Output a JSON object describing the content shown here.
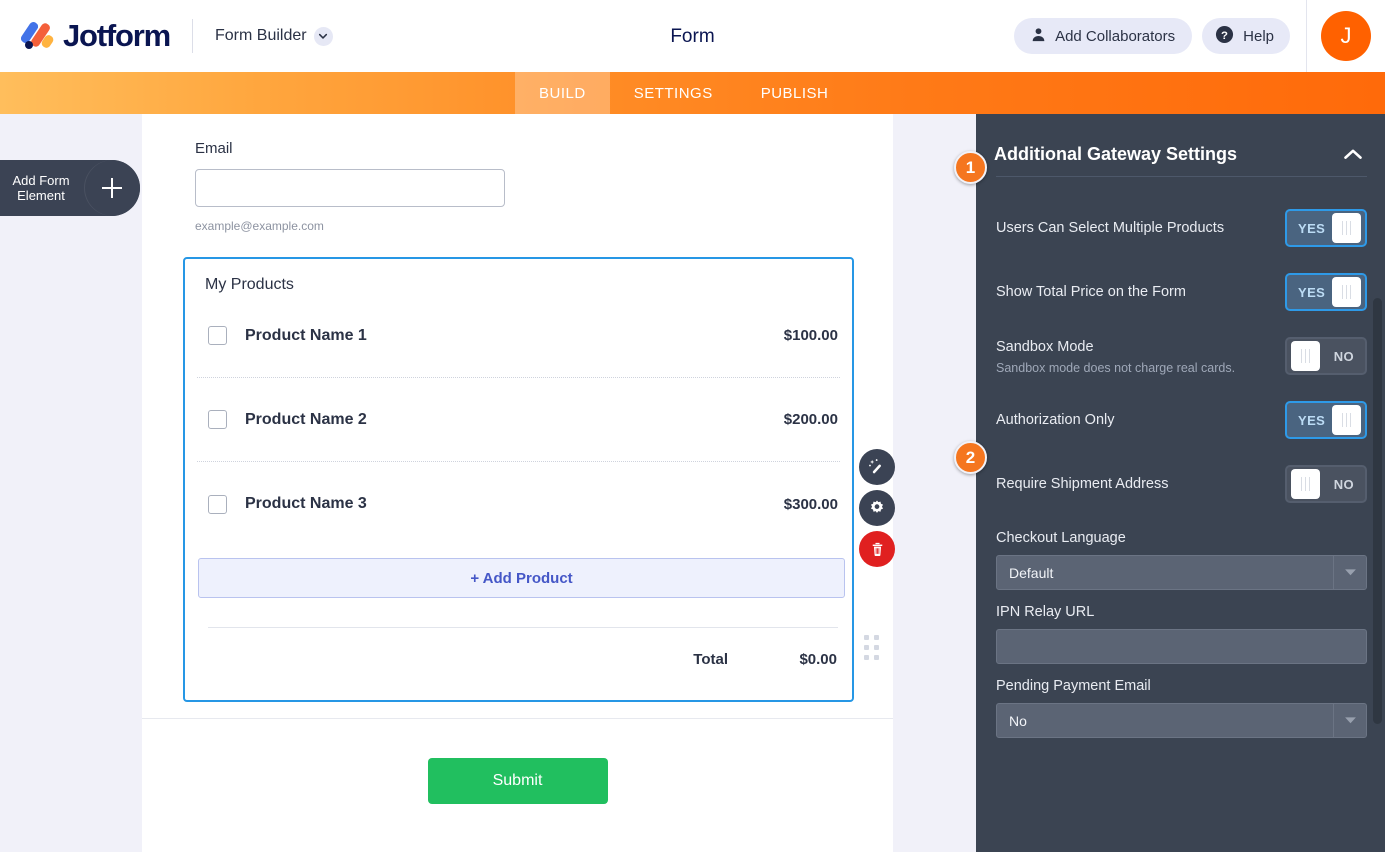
{
  "header": {
    "brand": "Jotform",
    "menu_label": "Form Builder",
    "form_title": "Form",
    "add_collaborators_label": "Add Collaborators",
    "help_label": "Help",
    "avatar_initial": "J",
    "icons": {
      "brand_logo": "jotform-logo",
      "chevron": "chevron-down-icon",
      "person": "person-icon",
      "question": "question-mark-icon"
    }
  },
  "tabs": [
    {
      "label": "BUILD",
      "active": true
    },
    {
      "label": "SETTINGS",
      "active": false
    },
    {
      "label": "PUBLISH",
      "active": false
    }
  ],
  "left_rail": {
    "add_element_label": "Add Form\nElement",
    "plus_icon": "plus-icon"
  },
  "form": {
    "email_field": {
      "label": "Email",
      "value": "",
      "placeholder": "",
      "hint": "example@example.com"
    },
    "products": {
      "title": "My Products",
      "items": [
        {
          "name": "Product Name 1",
          "price": "$100.00",
          "checked": false
        },
        {
          "name": "Product Name 2",
          "price": "$200.00",
          "checked": false
        },
        {
          "name": "Product Name 3",
          "price": "$300.00",
          "checked": false
        }
      ],
      "add_product_label": "+ Add Product",
      "total_label": "Total",
      "total_value": "$0.00"
    },
    "submit_label": "Submit",
    "element_actions": [
      {
        "name": "magic-wand-icon",
        "style": "dark"
      },
      {
        "name": "gear-icon",
        "style": "dark"
      },
      {
        "name": "trash-icon",
        "style": "red"
      }
    ]
  },
  "right_panel": {
    "title": "Additional Gateway Settings",
    "collapse_icon": "chevron-up-icon",
    "toggles": [
      {
        "label": "Users Can Select Multiple Products",
        "hint": "",
        "state": "YES",
        "on": true
      },
      {
        "label": "Show Total Price on the Form",
        "hint": "",
        "state": "YES",
        "on": true
      },
      {
        "label": "Sandbox Mode",
        "hint": "Sandbox mode does not charge real cards.",
        "state": "NO",
        "on": false
      },
      {
        "label": "Authorization Only",
        "hint": "",
        "state": "YES",
        "on": true
      },
      {
        "label": "Require Shipment Address",
        "hint": "",
        "state": "NO",
        "on": false
      }
    ],
    "fields": [
      {
        "type": "select",
        "label": "Checkout Language",
        "value": "Default"
      },
      {
        "type": "text",
        "label": "IPN Relay URL",
        "value": "",
        "placeholder": ""
      },
      {
        "type": "select",
        "label": "Pending Payment Email",
        "value": "No"
      }
    ]
  },
  "step_badges": [
    {
      "number": "1"
    },
    {
      "number": "2"
    }
  ],
  "colors": {
    "brand_navy": "#0a1551",
    "accent_orange": "#ff6100",
    "panel_bg": "#3b4452",
    "toggle_on": "#4a6480",
    "toggle_on_border": "#2e9ae8",
    "toggle_off": "#4a5260",
    "submit_green": "#21bf5f",
    "product_border_blue": "#2697e5",
    "trash_red": "#e02020",
    "badge_orange": "#f5761f"
  }
}
